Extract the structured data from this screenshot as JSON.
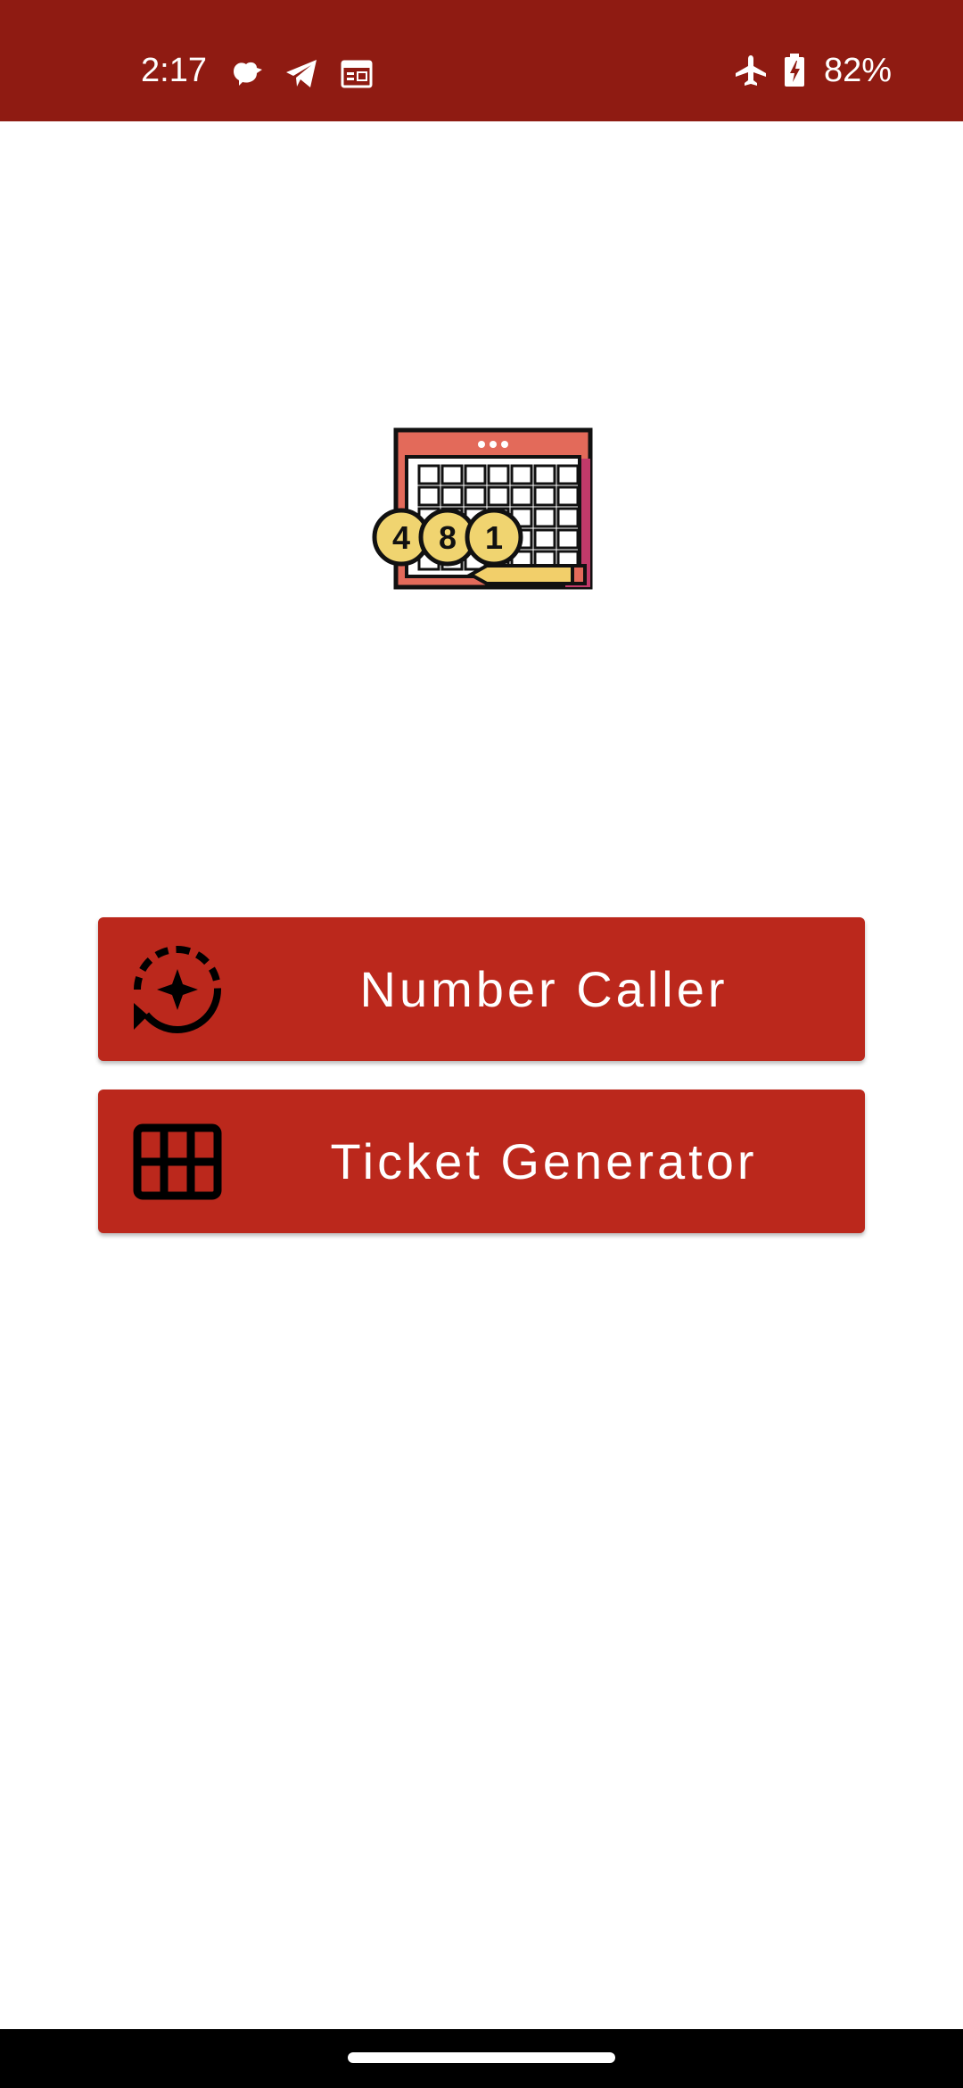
{
  "status_bar": {
    "time": "2:17",
    "battery_percent": "82%",
    "icons": [
      "notification-bird-icon",
      "telegram-icon",
      "calendar-icon",
      "airplane-mode-icon",
      "battery-charging-icon"
    ]
  },
  "logo": {
    "balls": [
      "4",
      "8",
      "1"
    ],
    "icon": "bingo-card-logo"
  },
  "buttons": {
    "number_caller": {
      "label": "Number Caller",
      "icon": "sync-star-icon"
    },
    "ticket_generator": {
      "label": "Ticket Generator",
      "icon": "grid-icon"
    }
  },
  "colors": {
    "status_bar": "#8f1b12",
    "button": "#bb281c",
    "button_text": "#ffffff",
    "background": "#ffffff"
  }
}
